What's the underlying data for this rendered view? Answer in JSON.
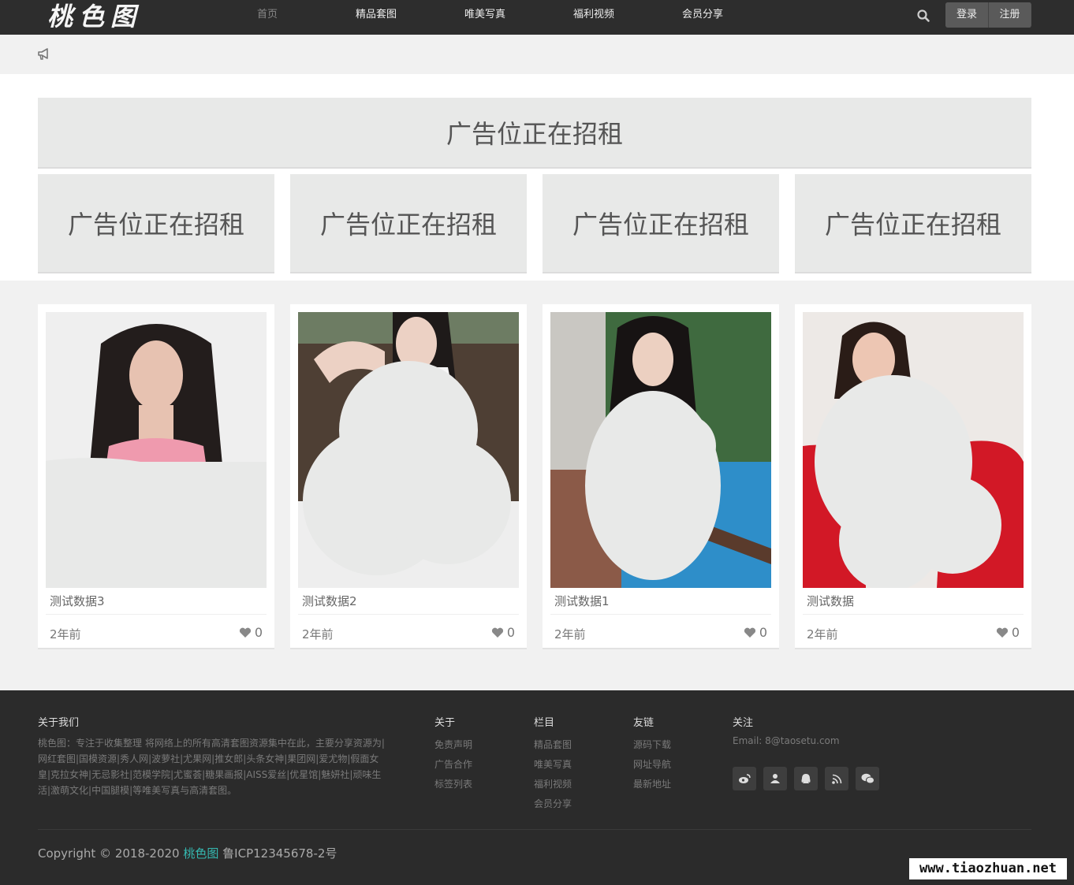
{
  "header": {
    "logo": "桃色图",
    "nav": [
      "首页",
      "精品套图",
      "唯美写真",
      "福利视频",
      "会员分享"
    ],
    "login": "登录",
    "register": "注册"
  },
  "ads": {
    "banner": "广告位正在招租",
    "slots": [
      "广告位正在招租",
      "广告位正在招租",
      "广告位正在招租",
      "广告位正在招租"
    ]
  },
  "cards": [
    {
      "title": "测试数据3",
      "time": "2年前",
      "likes": "0"
    },
    {
      "title": "测试数据2",
      "time": "2年前",
      "likes": "0"
    },
    {
      "title": "测试数据1",
      "time": "2年前",
      "likes": "0"
    },
    {
      "title": "测试数据",
      "time": "2年前",
      "likes": "0"
    }
  ],
  "footer": {
    "about_title": "关于我们",
    "about_text": "桃色图：专注于收集整理 将网络上的所有高清套图资源集中在此，主要分享资源为|网红套图|国模资源|秀人网|波萝社|尤果网|推女郎|头条女神|果团网|爱尤物|假面女皇|克拉女神|无忌影社|范模学院|尤蜜荟|糖果画报|AISS爱丝|优星馆|魅妍社|顽味生活|激萌文化|中国腿模|等唯美写真与高清套图。",
    "col1_title": "关于",
    "col1_items": [
      "免责声明",
      "广告合作",
      "标签列表"
    ],
    "col2_title": "栏目",
    "col2_items": [
      "精品套图",
      "唯美写真",
      "福利视频",
      "会员分享"
    ],
    "col3_title": "友链",
    "col3_items": [
      "源码下载",
      "网址导航",
      "最新地址"
    ],
    "col4_title": "关注",
    "email": "Email: 8@taosetu.com",
    "copyright_prefix": "Copyright © 2018-2020",
    "copyright_brand": "桃色图",
    "icp": "鲁ICP12345678-2号"
  },
  "watermark": "www.tiaozhuan.net",
  "colors": {
    "header_bg": "#2d2d2d",
    "footer_bg": "#2b2b2b",
    "brand_link": "#35b9b1",
    "ad_bg": "#e8e9e8"
  },
  "icons": [
    "search-icon",
    "megaphone-icon",
    "heart-icon",
    "weibo-icon",
    "user-icon",
    "qq-icon",
    "rss-icon",
    "wechat-icon"
  ]
}
